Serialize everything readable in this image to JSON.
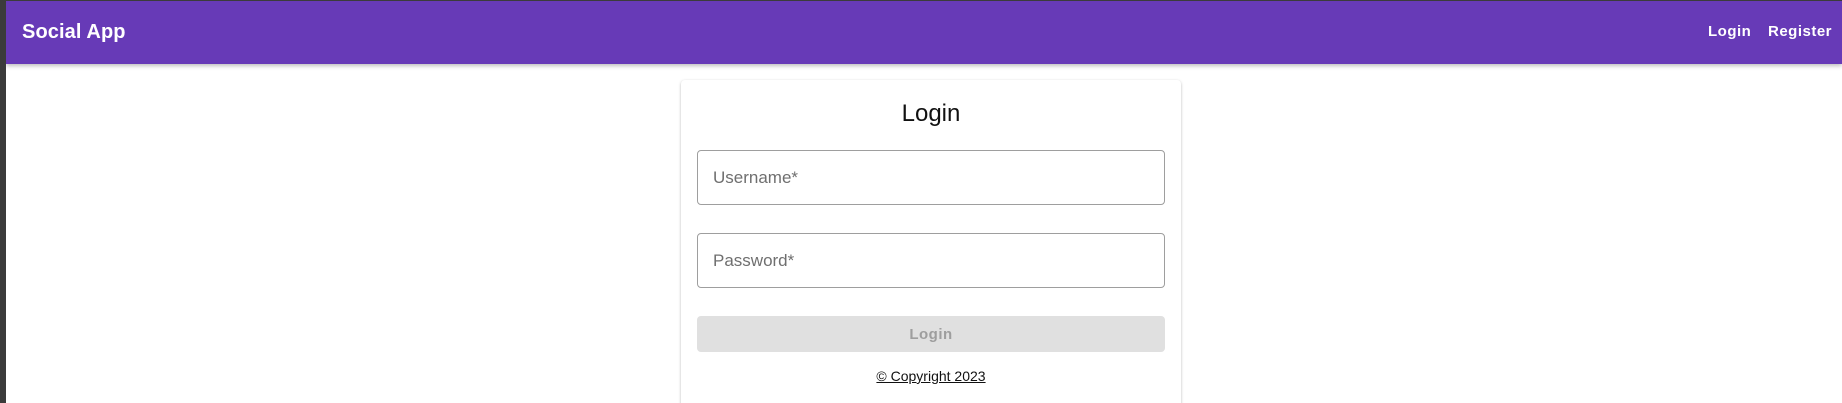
{
  "header": {
    "brand": "Social App",
    "nav": {
      "login_label": "Login",
      "register_label": "Register"
    },
    "color": "#673ab7"
  },
  "login_form": {
    "title": "Login",
    "username": {
      "placeholder": "Username*",
      "value": ""
    },
    "password": {
      "placeholder": "Password*",
      "value": ""
    },
    "submit_label": "Login",
    "submit_disabled": true
  },
  "footer": {
    "copyright": "© Copyright 2023"
  }
}
